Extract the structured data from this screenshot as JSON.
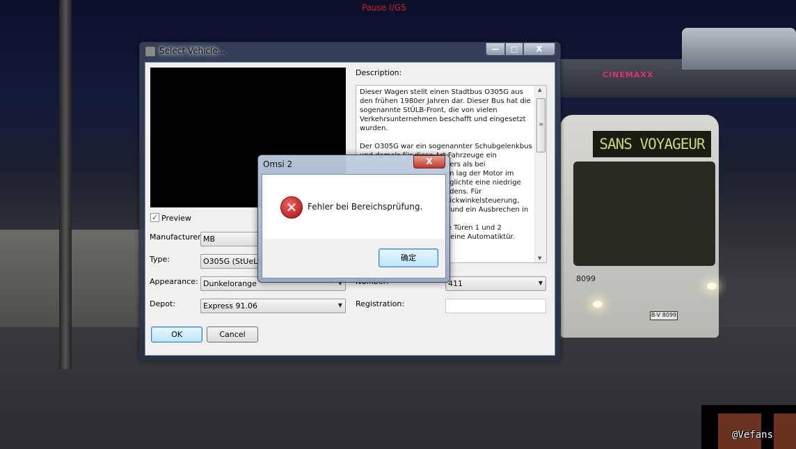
{
  "game": {
    "pause_text": "Pause I/G5",
    "sign_text": "CINEMAXX",
    "bus_destination": "SANS VOYAGEUR",
    "bus_number": "8099",
    "bus_plate": "B-V 8099",
    "watermark": "@Vefans"
  },
  "window": {
    "title": "Select Vehicle...",
    "minimize_label": "—",
    "maximize_label": "□",
    "close_label": "X",
    "preview_label": "Preview",
    "preview_checked": true,
    "fields": {
      "manufacturer": {
        "label": "Manufacturer:",
        "value": "MB"
      },
      "type": {
        "label": "Type:",
        "value": "O305G (StUeLB)"
      },
      "appearance": {
        "label": "Appearance:",
        "value": "Dunkelorange"
      },
      "depot": {
        "label": "Depot:",
        "value": "Express 91.06"
      },
      "number": {
        "label": "Number:",
        "value": "411"
      },
      "registration": {
        "label": "Registration:",
        "value": ""
      }
    },
    "description_label": "Description:",
    "description_lines": [
      "Dieser Wagen stellt einen Stadtbus O305G aus",
      "den frühen 1980er Jahren dar. Dieser Bus hat die",
      "sogenannte StÜLB-Front, die von vielen",
      "Verkehrsunternehmen beschafft und eingesetzt",
      "wurden.",
      "",
      "Der O305G war ein sogenannter Schubgelenkbus",
      "und damals für diese Art Fahrzeuge ein"
    ],
    "description_partial_lines": [
      "ders als bei",
      "en lag der Motor im",
      "öglichte eine niedrige",
      "odens. Für",
      "nickwinkelsteuerung,",
      "t und ein Ausbrechen in",
      "",
      "ie Türen 1 und 2",
      "t eine Automatiktür."
    ],
    "ok_label": "OK",
    "cancel_label": "Cancel"
  },
  "dialog": {
    "title": "Omsi 2",
    "close_label": "X",
    "message": "Fehler bei Bereichsprüfung.",
    "icon": "error-icon",
    "ok_label": "确定"
  }
}
